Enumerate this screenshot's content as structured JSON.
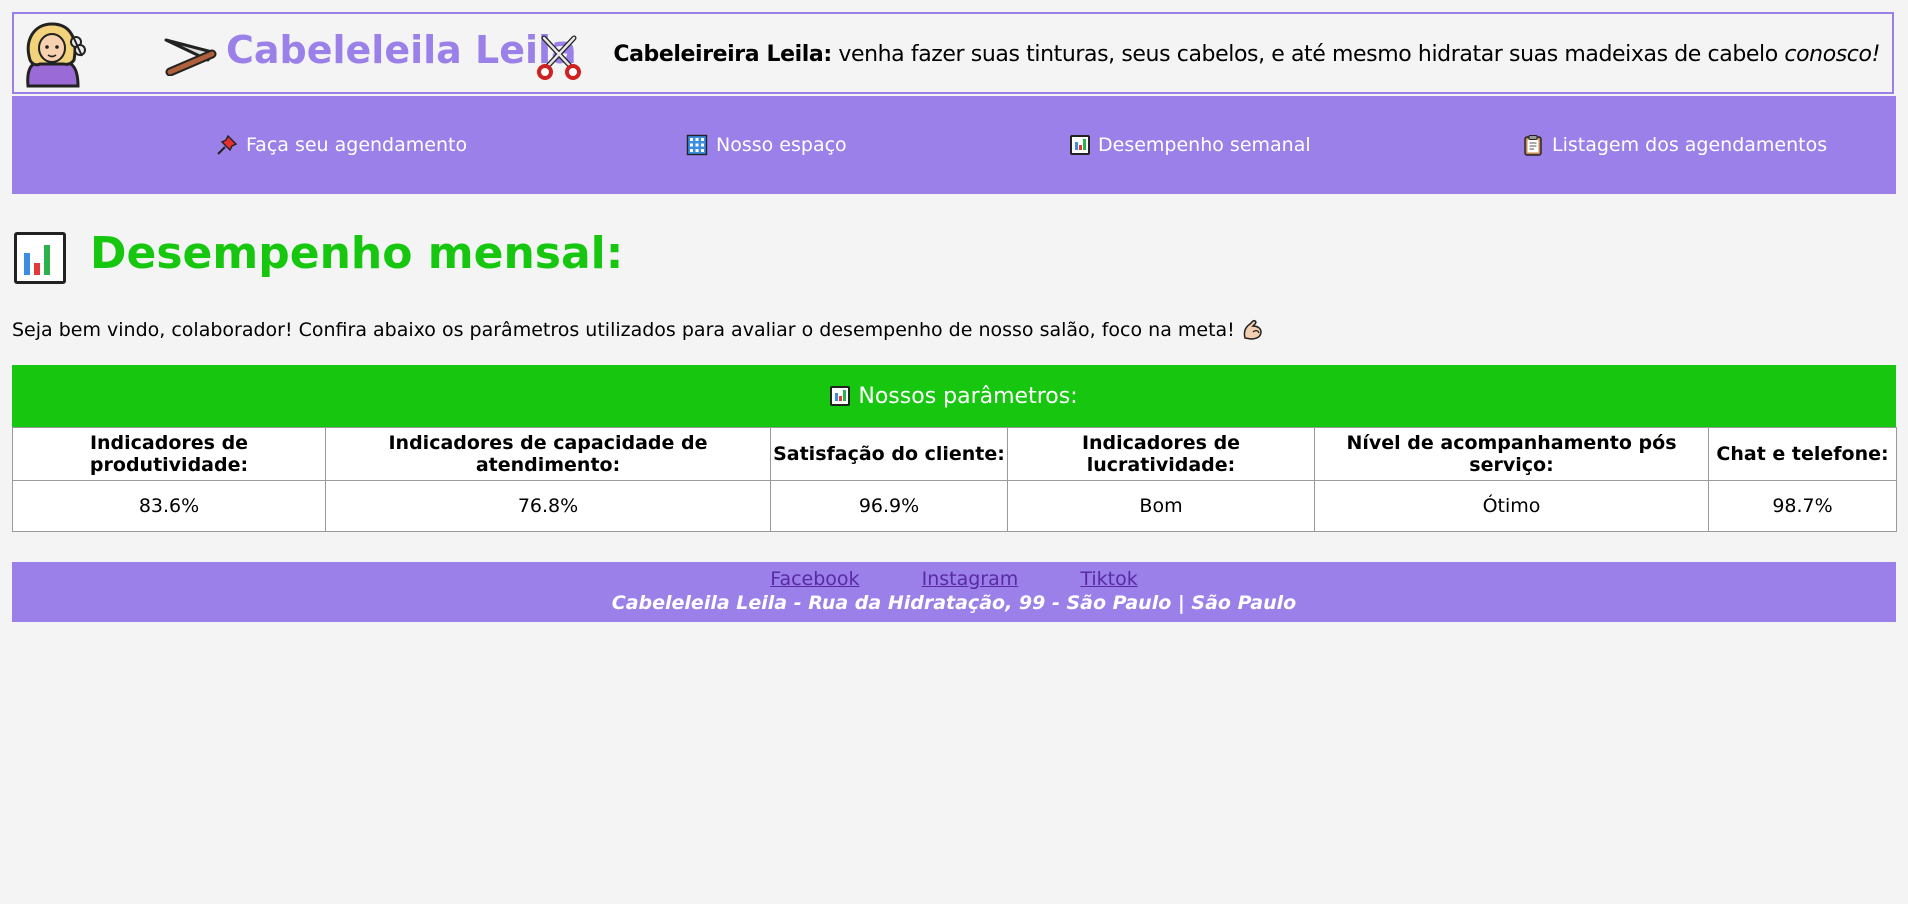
{
  "header": {
    "brand": "Cabeleleila Leila",
    "tagline_label": "Cabeleireira Leila:",
    "tagline_text": " venha fazer suas tinturas, seus cabelos, e até mesmo hidratar suas madeixas de cabelo ",
    "tagline_emphasis": "conosco!"
  },
  "nav": {
    "items": [
      {
        "label": "Faça seu agendamento",
        "icon": "pushpin-icon"
      },
      {
        "label": "Nosso espaço",
        "icon": "building-icon"
      },
      {
        "label": "Desempenho semanal",
        "icon": "bar-chart-icon"
      },
      {
        "label": "Listagem dos agendamentos",
        "icon": "clipboard-icon"
      }
    ]
  },
  "main": {
    "title": "Desempenho mensal:",
    "intro": "Seja bem vindo, colaborador! Confira abaixo os parâmetros utilizados para avaliar o desempenho de nosso salão, foco na meta!",
    "table_caption": "Nossos parâmetros:",
    "columns": [
      "Indicadores de produtividade:",
      "Indicadores de capacidade de atendimento:",
      "Satisfação do cliente:",
      "Indicadores de lucratividade:",
      "Nível de acompanhamento pós serviço:",
      "Chat e telefone:"
    ],
    "values": [
      "83.6%",
      "76.8%",
      "96.9%",
      "Bom",
      "Ótimo",
      "98.7%"
    ]
  },
  "footer": {
    "links": [
      "Facebook",
      "Instagram",
      "Tiktok"
    ],
    "address": "Cabeleleila Leila - Rua da Hidratação, 99 - São Paulo | São Paulo"
  },
  "colors": {
    "purple": "#9a80e8",
    "green": "#17c60f",
    "background": "#f4f4f4"
  }
}
